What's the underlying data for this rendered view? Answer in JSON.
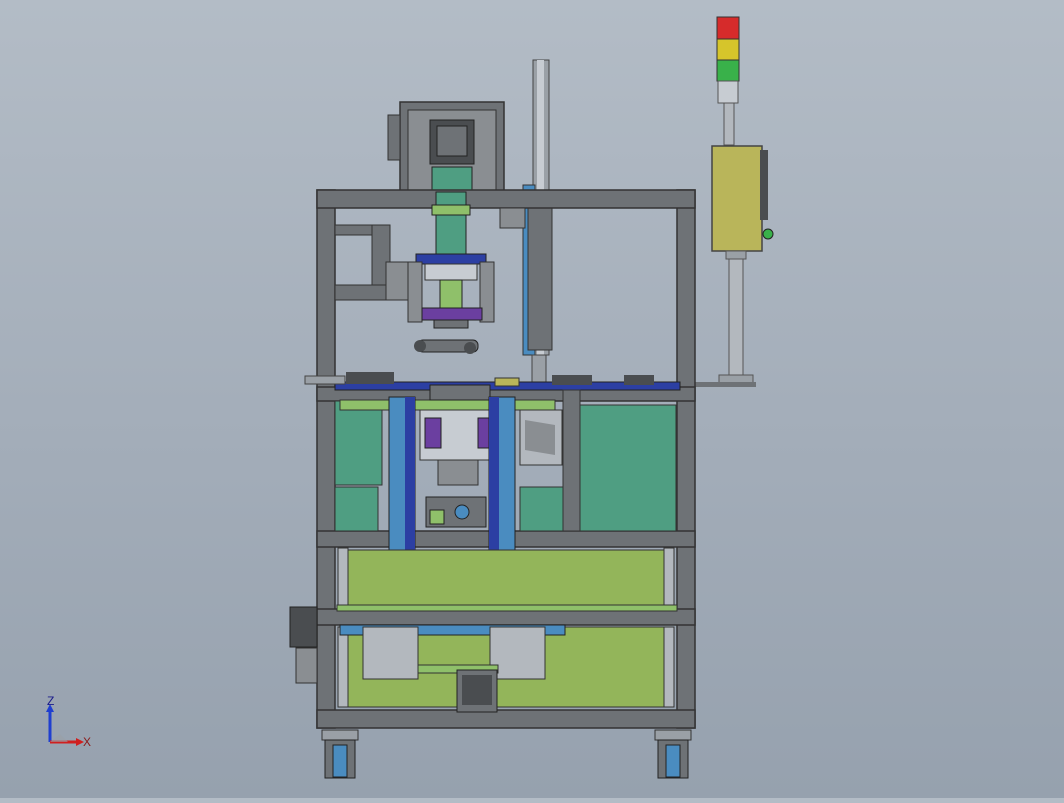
{
  "viewport": {
    "background_top": "#b3bcc6",
    "background_bottom": "#96a1ae"
  },
  "triad": {
    "z_label": "Z",
    "x_label": "X",
    "z_color": "#1f3fd0",
    "x_color": "#d01f1f"
  },
  "colors": {
    "frame": "#6e7276",
    "frame_dark": "#4a4d50",
    "panel_green": "#4f9e82",
    "panel_olive": "#93b55a",
    "rail_blue": "#4a8cc0",
    "rail_dark_blue": "#2c3fa3",
    "purple": "#6b3fa0",
    "light_green": "#8fc06a",
    "olive_box": "#b9b55a",
    "lamp_red": "#d62b2b",
    "lamp_yellow": "#d6c52b",
    "lamp_green": "#39b14a",
    "steel": "#9aa0a6"
  }
}
